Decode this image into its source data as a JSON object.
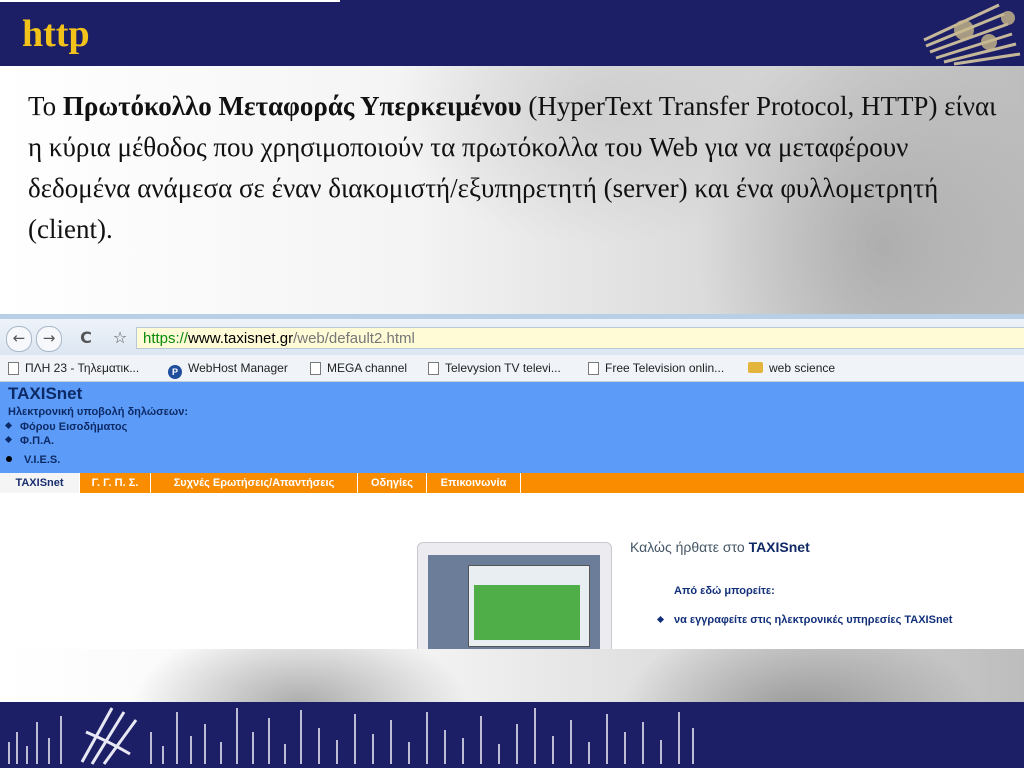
{
  "slide": {
    "title": "http",
    "body": {
      "intro": "Το ",
      "term": "Πρωτόκολλο Μεταφοράς Υπερκειμένου",
      "rest": " (HyperText Transfer Protocol, HTTP) είναι η κύρια μέθοδος που χρησιμοποιούν τα πρωτόκολλα του Web για να μεταφέρουν δεδομένα ανάμεσα σε έναν διακομιστή/εξυπηρετητή (server) και ένα φυλλομετρητή (client)."
    }
  },
  "browser": {
    "nav": {
      "back_icon": "←",
      "forward_icon": "→",
      "reload_icon": "C",
      "star_icon": "☆"
    },
    "address": {
      "scheme": "https://",
      "domain": "www.taxisnet.gr",
      "path": "/web/default2.html"
    },
    "bookmarks": [
      {
        "label": "ΠΛΗ 23 - Τηλεματικ...",
        "icon": "page-icon"
      },
      {
        "label": "WebHost Manager",
        "icon": "cpanel-icon"
      },
      {
        "label": "MEGA channel",
        "icon": "page-icon"
      },
      {
        "label": "Televysion TV televi...",
        "icon": "page-icon"
      },
      {
        "label": "Free Television onlin...",
        "icon": "page-icon"
      },
      {
        "label": "web science",
        "icon": "folder-icon"
      }
    ],
    "cpanel_glyph": "P"
  },
  "taxisnet": {
    "name": "TAXISnet",
    "subtitle": "Ηλεκτρονική υποβολή δηλώσεων:",
    "list": [
      "Φόρου Εισοδήματος",
      "Φ.Π.Α.",
      "V.I.E.S."
    ],
    "menu": [
      "TAXISnet",
      "Γ. Γ. Π. Σ.",
      "Συχνές Ερωτήσεις/Απαντήσεις",
      "Οδηγίες",
      "Επικοινωνία"
    ],
    "welcome_prefix": "Καλώς ήρθατε στο ",
    "welcome_brand": "TAXISnet",
    "can_text": "Από εδώ μπορείτε:",
    "register_text": "να εγγραφείτε στις ηλεκτρονικές υπηρεσίες TAXISnet"
  },
  "colors": {
    "header_navy": "#1c1f66",
    "title_gold": "#f2c21a",
    "taxis_blue": "#5c9cf8",
    "menu_orange": "#fa8c00",
    "address_bar": "#fffbd7"
  }
}
